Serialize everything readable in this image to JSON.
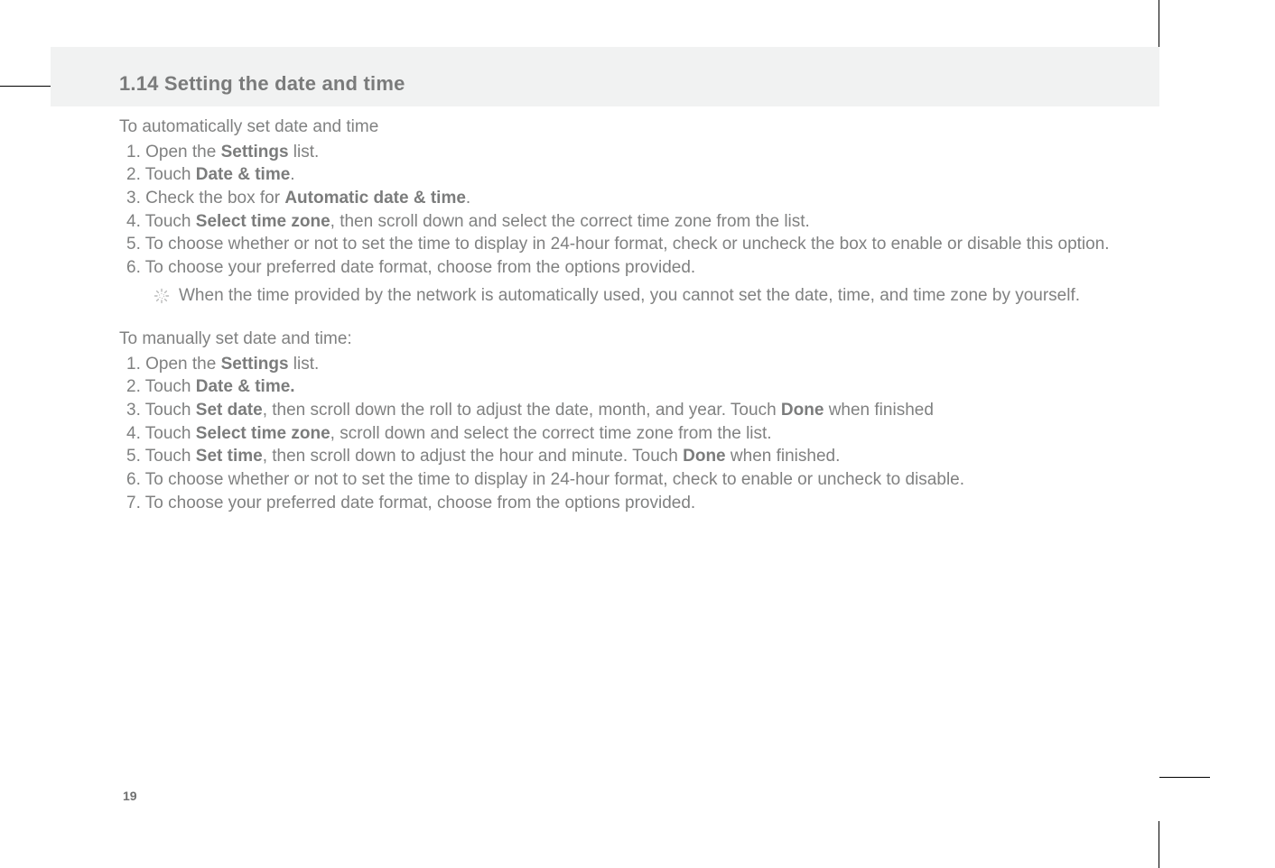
{
  "heading": "1.14 Setting the date and time",
  "auto": {
    "intro": "To automatically set date and time",
    "s1_a": "1. Open the ",
    "s1_b": "Settings",
    "s1_c": " list.",
    "s2_a": "2. Touch ",
    "s2_b": "Date & time",
    "s2_c": ".",
    "s3_a": "3. Check the box for ",
    "s3_b": "Automatic date & time",
    "s3_c": ".",
    "s4_a": "4. Touch ",
    "s4_b": "Select time zone",
    "s4_c": ", then scroll down and select the correct time zone from the list.",
    "s5": "5. To choose whether or not to set the time to display in 24-hour format, check or uncheck the box to enable or disable this option.",
    "s6": "6. To choose your preferred date format, choose from the options provided.",
    "note": "When the time provided by the network is automatically used, you cannot set the date, time, and time zone by yourself."
  },
  "manual": {
    "intro": "To manually set date and time:",
    "s1_a": "1. Open the ",
    "s1_b": "Settings",
    "s1_c": " list.",
    "s2_a": "2. Touch ",
    "s2_b": "Date & time.",
    "s3_a": "3. Touch ",
    "s3_b": "Set date",
    "s3_c": ", then scroll down the roll to adjust the date, month, and year. Touch ",
    "s3_d": "Done",
    "s3_e": " when finished",
    "s4_a": "4. Touch ",
    "s4_b": "Select time zone",
    "s4_c": ", scroll down and select the correct time zone from the list.",
    "s5_a": "5. Touch ",
    "s5_b": "Set time",
    "s5_c": ", then scroll down to adjust the hour and minute. Touch ",
    "s5_d": "Done",
    "s5_e": " when finished.",
    "s6": "6. To choose whether or not to set the time to display in 24-hour format, check to enable or uncheck to disable.",
    "s7": "7. To choose your preferred date format, choose from the options provided."
  },
  "page_number": "19"
}
